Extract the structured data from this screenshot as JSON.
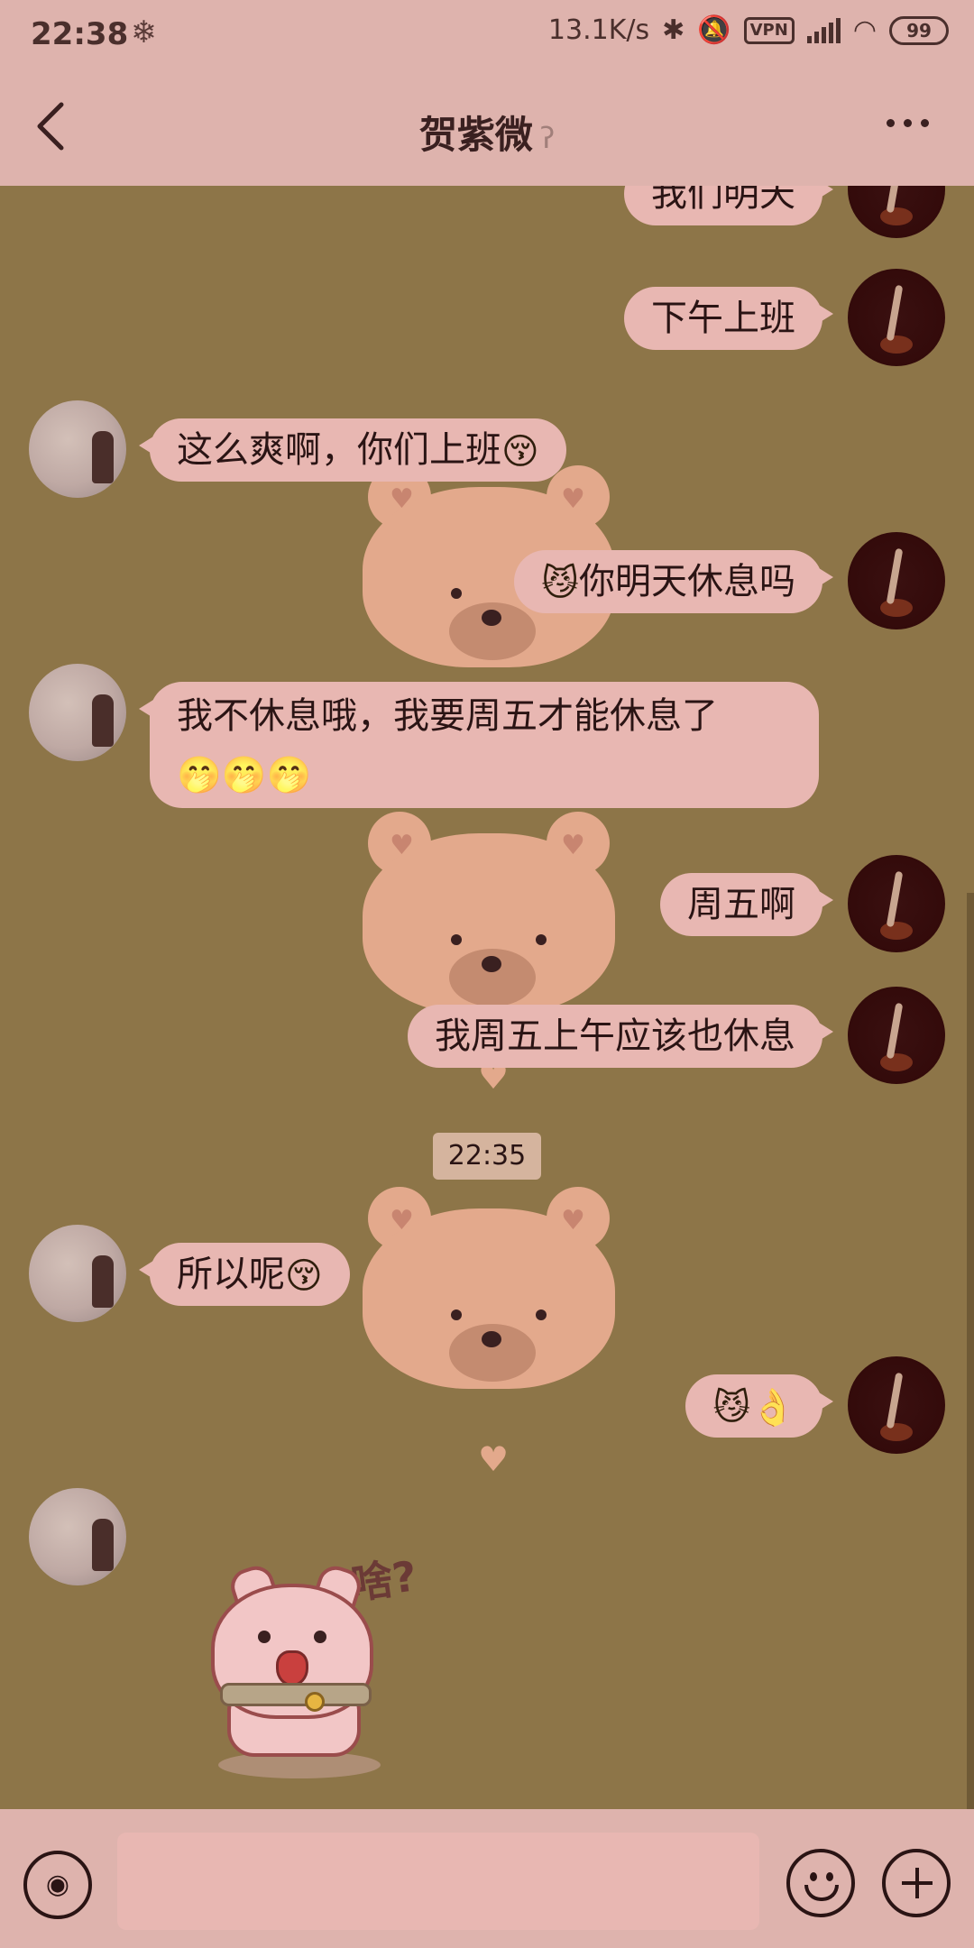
{
  "status_bar": {
    "time": "22:38",
    "network_speed": "13.1K/s",
    "vpn_label": "VPN",
    "battery": "99"
  },
  "header": {
    "title": "贺紫微"
  },
  "messages": [
    {
      "side": "right",
      "text": "我们明天"
    },
    {
      "side": "right",
      "text": "下午上班"
    },
    {
      "side": "left",
      "text": "这么爽啊，你们上班",
      "emoji": "😚"
    },
    {
      "side": "right",
      "emoji": "😼",
      "text": "你明天休息吗"
    },
    {
      "side": "left",
      "text": "我不休息哦，我要周五才能休息了",
      "emojis": "🤭🤭🤭"
    },
    {
      "side": "right",
      "text": "周五啊"
    },
    {
      "side": "right",
      "text": "我周五上午应该也休息"
    },
    {
      "type": "timestamp",
      "text": "22:35"
    },
    {
      "side": "left",
      "text": "所以呢",
      "emoji": "😚"
    },
    {
      "side": "right",
      "emojis": "😼👌"
    },
    {
      "side": "left",
      "type": "sticker",
      "text": "啥?"
    }
  ],
  "input_bar": {
    "placeholder": ""
  },
  "colors": {
    "background": "#8d7548",
    "header": "#deb3ad",
    "bubble": "#e8b7b2"
  }
}
